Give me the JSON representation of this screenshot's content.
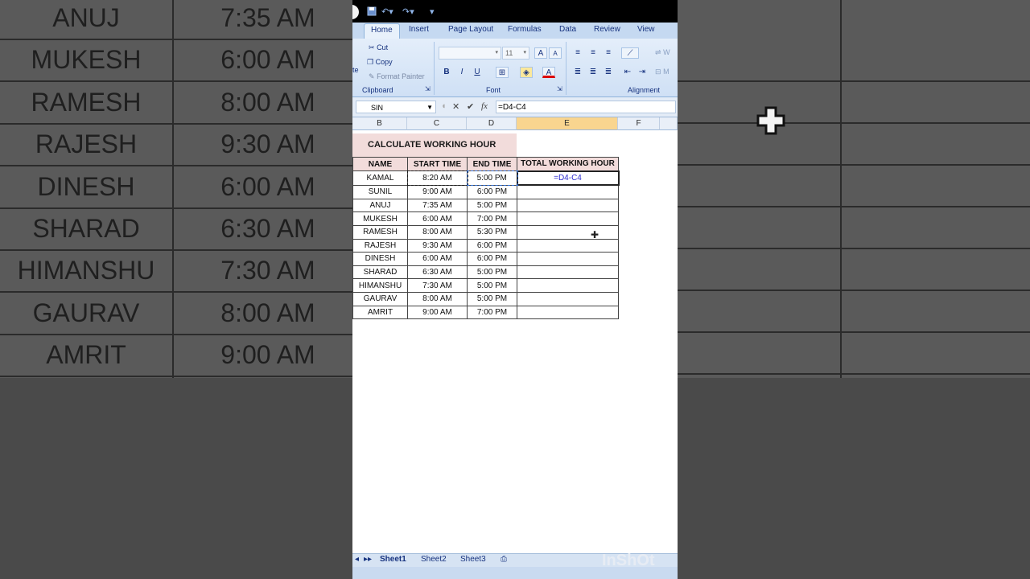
{
  "background": {
    "left_rows": [
      {
        "name": "ANUJ",
        "time": "7:35 AM"
      },
      {
        "name": "MUKESH",
        "time": "6:00 AM"
      },
      {
        "name": "RAMESH",
        "time": "8:00 AM"
      },
      {
        "name": "RAJESH",
        "time": "9:30 AM"
      },
      {
        "name": "DINESH",
        "time": "6:00 AM"
      },
      {
        "name": "SHARAD",
        "time": "6:30 AM"
      },
      {
        "name": "HIMANSHU",
        "time": "7:30 AM"
      },
      {
        "name": "GAURAV",
        "time": "8:00 AM"
      },
      {
        "name": "AMRIT",
        "time": "9:00 AM"
      }
    ]
  },
  "ribbon": {
    "tabs": [
      "Home",
      "Insert",
      "Page Layout",
      "Formulas",
      "Data",
      "Review",
      "View"
    ],
    "active_tab": "Home",
    "clipboard": {
      "cut": "Cut",
      "copy": "Copy",
      "format_painter": "Format Painter",
      "label": "Clipboard",
      "paste_fragment": "te"
    },
    "font": {
      "size": "11",
      "label": "Font",
      "bold": "B",
      "italic": "I",
      "underline": "U",
      "grow": "A",
      "shrink": "A",
      "color": "A"
    },
    "alignment": {
      "label": "Alignment",
      "wrap": "W",
      "merge": "M"
    }
  },
  "formula_bar": {
    "name_box": "SIN",
    "formula": "=D4-C4",
    "fx": "fx"
  },
  "columns": [
    "B",
    "C",
    "D",
    "E",
    "F"
  ],
  "sheet": {
    "title": "CALCULATE WORKING HOUR",
    "headers": [
      "NAME",
      "START TIME",
      "END TIME",
      "TOTAL WORKING HOUR"
    ],
    "rows": [
      {
        "name": "KAMAL",
        "start": "8:20 AM",
        "end": "5:00 PM",
        "total": ""
      },
      {
        "name": "SUNIL",
        "start": "9:00 AM",
        "end": "6:00 PM",
        "total": ""
      },
      {
        "name": "ANUJ",
        "start": "7:35 AM",
        "end": "5:00 PM",
        "total": ""
      },
      {
        "name": "MUKESH",
        "start": "6:00 AM",
        "end": "7:00 PM",
        "total": ""
      },
      {
        "name": "RAMESH",
        "start": "8:00 AM",
        "end": "5:30 PM",
        "total": ""
      },
      {
        "name": "RAJESH",
        "start": "9:30 AM",
        "end": "6:00 PM",
        "total": ""
      },
      {
        "name": "DINESH",
        "start": "6:00 AM",
        "end": "6:00 PM",
        "total": ""
      },
      {
        "name": "SHARAD",
        "start": "6:30 AM",
        "end": "5:00 PM",
        "total": ""
      },
      {
        "name": "HIMANSHU",
        "start": "7:30 AM",
        "end": "5:00 PM",
        "total": ""
      },
      {
        "name": "GAURAV",
        "start": "8:00 AM",
        "end": "5:00 PM",
        "total": ""
      },
      {
        "name": "AMRIT",
        "start": "9:00 AM",
        "end": "7:00 PM",
        "total": ""
      }
    ],
    "editing_cell_text": "=D4-C4"
  },
  "sheet_tabs": [
    "Sheet1",
    "Sheet2",
    "Sheet3"
  ],
  "active_sheet": "Sheet1",
  "watermark": "InShOt"
}
